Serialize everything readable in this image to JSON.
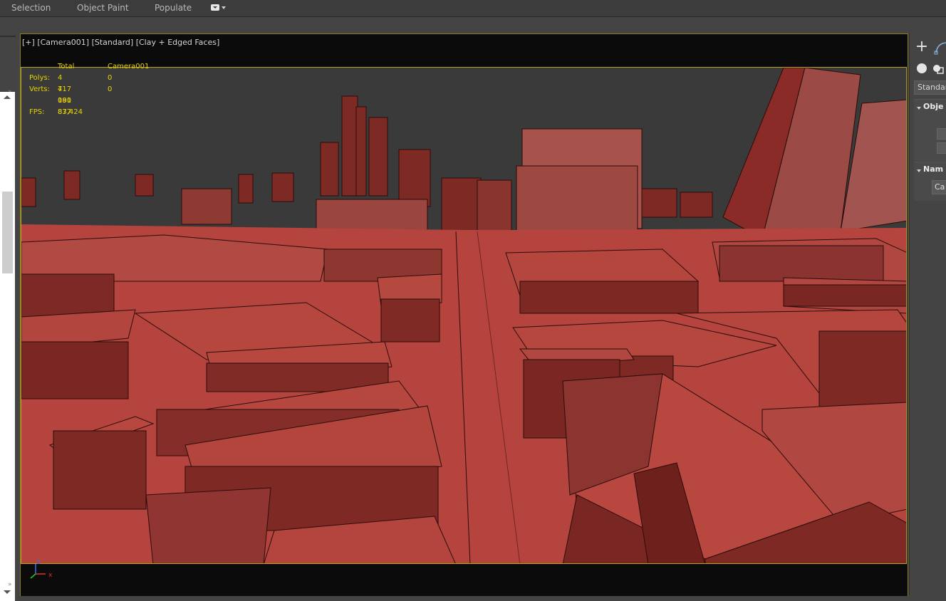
{
  "ribbon": {
    "tabs": [
      "Selection",
      "Object Paint",
      "Populate"
    ],
    "extra_dropdown_icon": "ribbon-options-icon"
  },
  "viewport": {
    "label": {
      "plus": "[+]",
      "view": "[Camera001]",
      "shading_mode": "[Standard]",
      "display": "[Clay + Edged Faces]"
    },
    "stats": {
      "col_total": "Total",
      "col_camera": "Camera001",
      "polys_label": "Polys:",
      "polys_total": "4 717 191",
      "polys_camera": "0",
      "verts_label": "Verts:",
      "verts_total": "4 080 877",
      "verts_camera": "0",
      "fps_label": "FPS:",
      "fps_value": "83,424"
    },
    "scene_color": "#b4443d",
    "sky_color": "#3a3a3a",
    "axis_labels": {
      "z": "z",
      "x": "x"
    }
  },
  "command_panel": {
    "create_tab_icon": "plus-icon",
    "modify_tab_icon": "curve-icon",
    "category_icons": [
      "geometry-circle-icon",
      "shapes-icon"
    ],
    "dropdown_value": "Standard",
    "rollout_object_type": "Obje",
    "rollout_name": "Nam",
    "name_value": "Ca"
  }
}
